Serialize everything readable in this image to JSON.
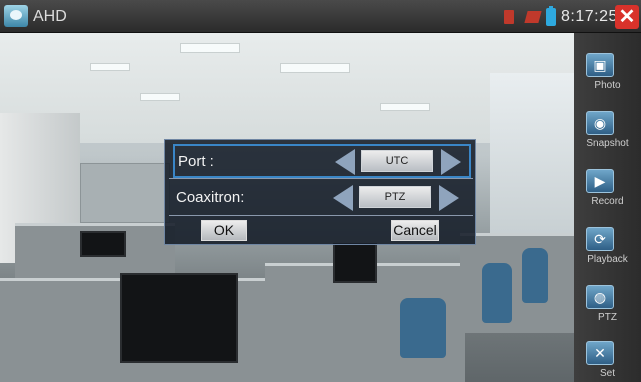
{
  "topbar": {
    "title": "AHD",
    "clock": "8:17:25",
    "close_label": "✕",
    "icons": [
      "app-icon",
      "sd-card-icon",
      "network-icon",
      "battery-icon",
      "close-icon"
    ]
  },
  "sidebar": {
    "items": [
      {
        "label": "Photo",
        "icon": "photo-icon",
        "glyph": "▣"
      },
      {
        "label": "Snapshot",
        "icon": "camera-icon",
        "glyph": "◉"
      },
      {
        "label": "Record",
        "icon": "record-icon",
        "glyph": "▶"
      },
      {
        "label": "Playback",
        "icon": "playback-icon",
        "glyph": "⟳"
      },
      {
        "label": "PTZ",
        "icon": "ptz-icon",
        "glyph": "◍"
      },
      {
        "label": "Set",
        "icon": "tools-icon",
        "glyph": "✕"
      }
    ]
  },
  "dialog": {
    "port": {
      "label": "Port :",
      "value": "UTC"
    },
    "coaxitron": {
      "label": "Coaxitron:",
      "value": "PTZ"
    },
    "ok_label": "OK",
    "cancel_label": "Cancel"
  },
  "colors": {
    "accent_blue": "#3a86c7",
    "close_red": "#d9322b",
    "status_red": "#c0392b",
    "battery_blue": "#2ea9df"
  }
}
